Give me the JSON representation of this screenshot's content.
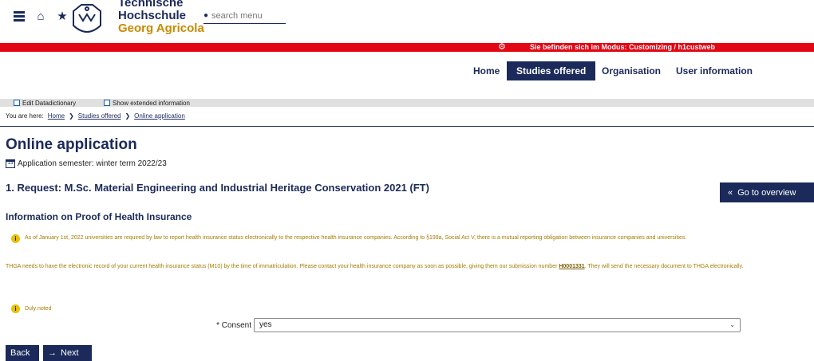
{
  "header": {
    "logo_lines": [
      "Technische",
      "Hochschule",
      "Georg Agricola"
    ],
    "search_placeholder": "search menu"
  },
  "mode_banner": "Sie befinden sich im Modus: Customizing / h1custweb",
  "nav": [
    {
      "label": "Home",
      "active": false
    },
    {
      "label": "Studies offered",
      "active": true
    },
    {
      "label": "Organisation",
      "active": false
    },
    {
      "label": "User information",
      "active": false
    }
  ],
  "toolbar": {
    "edit_label": "Edit Datadictionary",
    "extended_label": "Show extended information"
  },
  "breadcrumb": {
    "prefix": "You are here:",
    "items": [
      "Home",
      "Studies offered",
      "Online application"
    ]
  },
  "page": {
    "title": "Online application",
    "semester": "Application semester: winter term 2022/23",
    "request": "1. Request: M.Sc. Material Engineering and Industrial Heritage Conservation 2021 (FT)",
    "goto_overview": "Go to overview",
    "section_title": "Information on Proof of Health Insurance",
    "info_1": "As of January 1st, 2022 universities are required by law to report health insurance status electronically to the respective health insurance companies. According to §199a, Social Act V, there is a mutual reporting obligation between insurance companies and universities.",
    "info_2_before": "THGA needs to have the electronic record of your current health insurance status (M10) by the time of immatriculation. Please contact your health insurance company as soon as possible, giving them our submission number",
    "submission_number": "H0001331",
    "info_2_after": ". They will send the necessary document to THGA electronically.",
    "duly_noted": "Duly noted",
    "consent_label": "* Consent",
    "consent_value": "yes",
    "back_label": "Back",
    "next_label": "Next"
  },
  "colors": {
    "brand_navy": "#1b2a5a",
    "brand_gold": "#c98a00",
    "mode_red": "#e30613",
    "info_text": "#a67b00"
  }
}
